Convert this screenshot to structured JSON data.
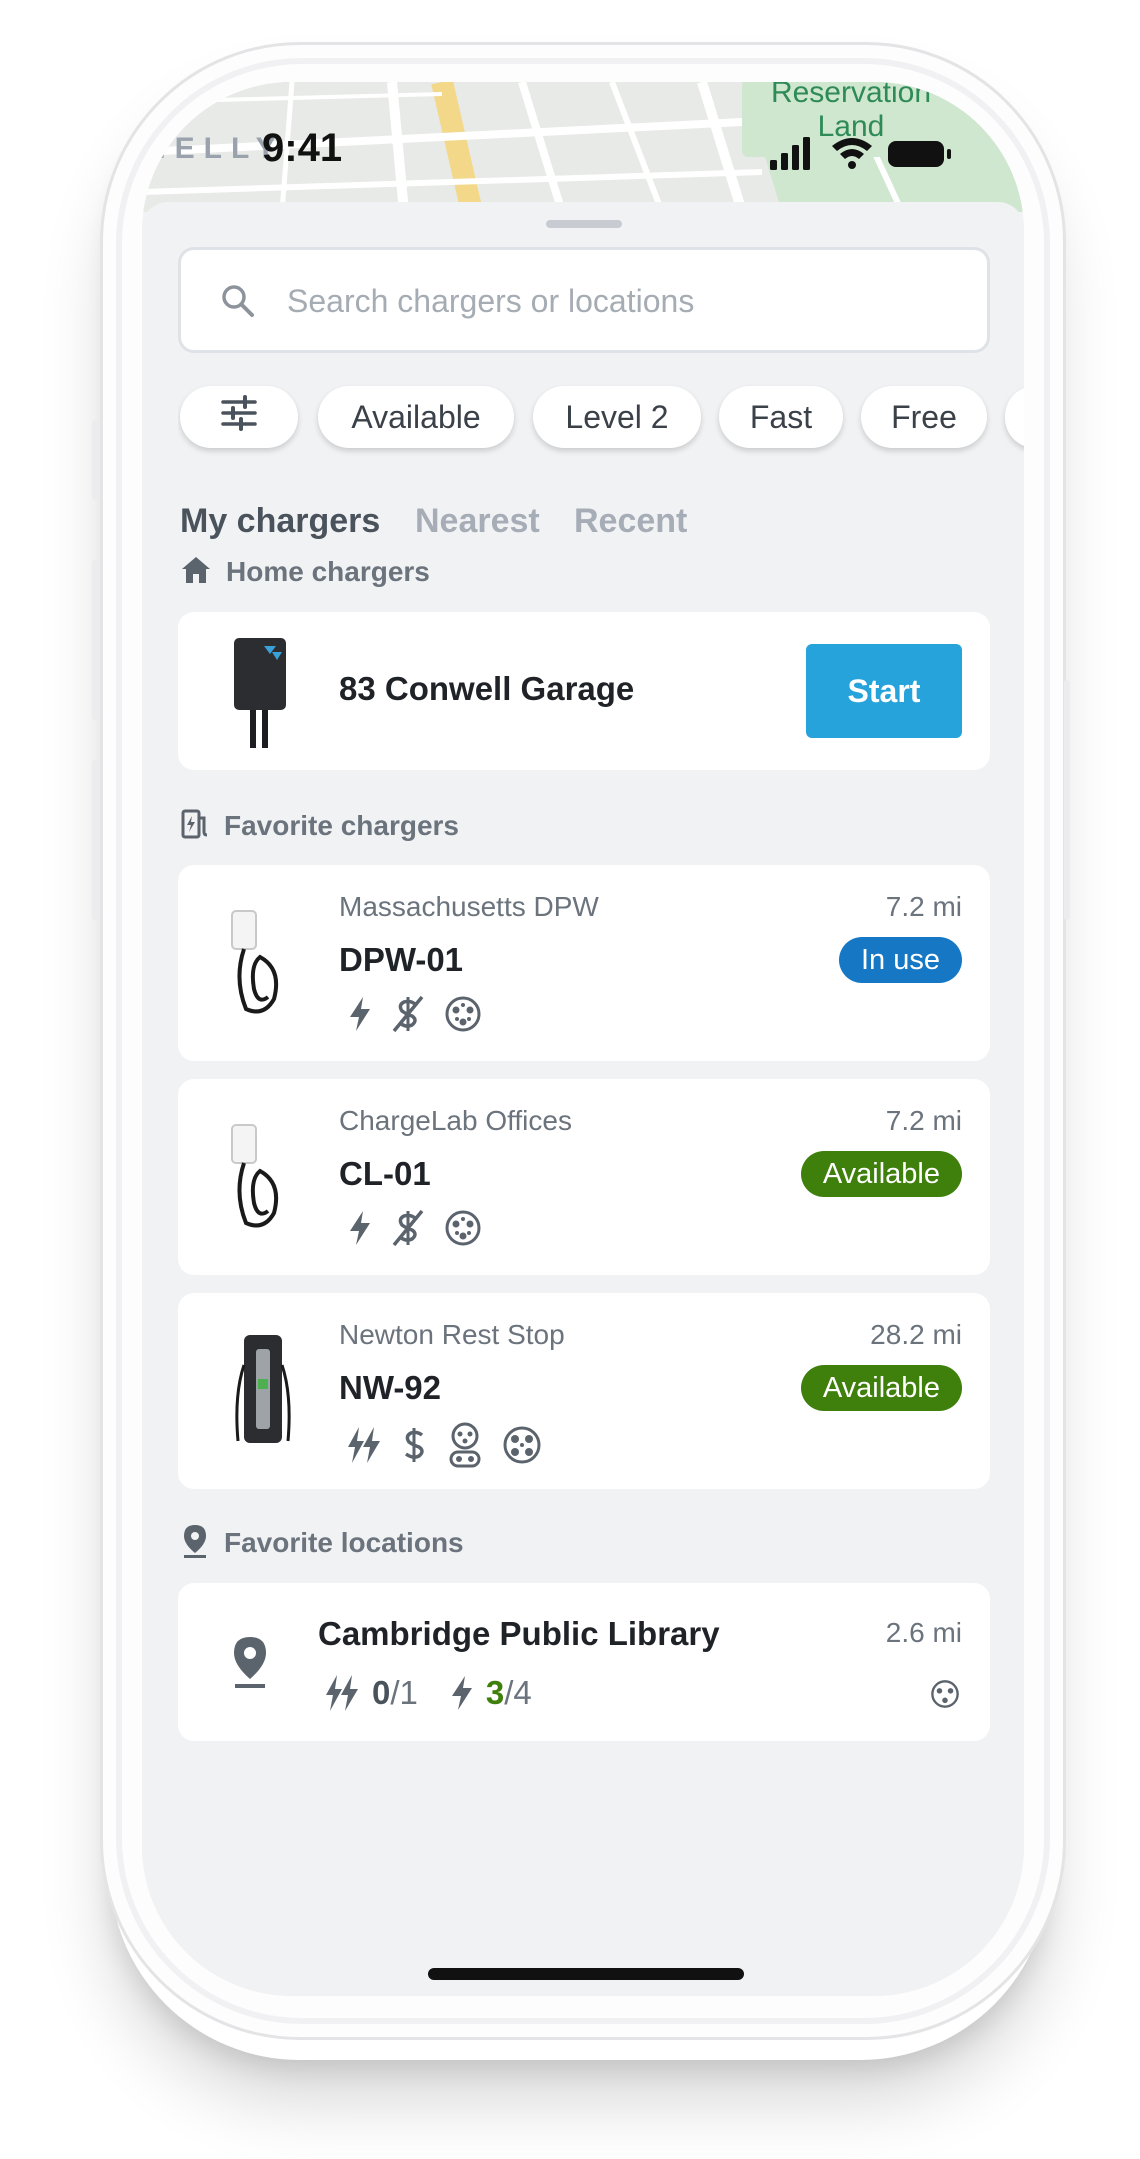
{
  "status_bar": {
    "time": "9:41"
  },
  "map": {
    "place_label": "Reservation Land",
    "brand_fragment": "NELLY"
  },
  "search": {
    "placeholder": "Search chargers or locations",
    "value": ""
  },
  "filters": {
    "chips": [
      "Available",
      "Level 2",
      "Fast",
      "Free"
    ],
    "settings_icon": "sliders-icon"
  },
  "tabs": [
    {
      "label": "My chargers",
      "active": true
    },
    {
      "label": "Nearest",
      "active": false
    },
    {
      "label": "Recent",
      "active": false
    }
  ],
  "home_section": {
    "label": "Home chargers",
    "icon": "home-icon",
    "chargers": [
      {
        "name": "83 Conwell Garage",
        "action": "Start",
        "action_color": "#27a3dc"
      }
    ]
  },
  "favorites_section": {
    "label": "Favorite chargers",
    "icon": "ev-station-icon",
    "chargers": [
      {
        "site": "Massachusetts DPW",
        "name": "DPW-01",
        "distance": "7.2 mi",
        "status": "In use",
        "status_color": "#1677c4",
        "icons": [
          "lightning-icon",
          "no-cost-icon",
          "connector-j1772-icon"
        ]
      },
      {
        "site": "ChargeLab Offices",
        "name": "CL-01",
        "distance": "7.2 mi",
        "status": "Available",
        "status_color": "#3f7f0c",
        "icons": [
          "lightning-icon",
          "no-cost-icon",
          "connector-j1772-icon"
        ]
      },
      {
        "site": "Newton Rest Stop",
        "name": "NW-92",
        "distance": "28.2 mi",
        "status": "Available",
        "status_color": "#3f7f0c",
        "icons": [
          "fast-charge-icon",
          "dollar-icon",
          "connector-ccs-icon",
          "connector-chademo-icon"
        ]
      }
    ]
  },
  "locations_section": {
    "label": "Favorite locations",
    "icon": "map-pin-icon",
    "locations": [
      {
        "name": "Cambridge Public Library",
        "distance": "2.6 mi",
        "fast_available": "0",
        "fast_total": "/1",
        "level2_available": "3",
        "level2_total": "/4",
        "available_color": "#3f7f0c"
      }
    ]
  }
}
